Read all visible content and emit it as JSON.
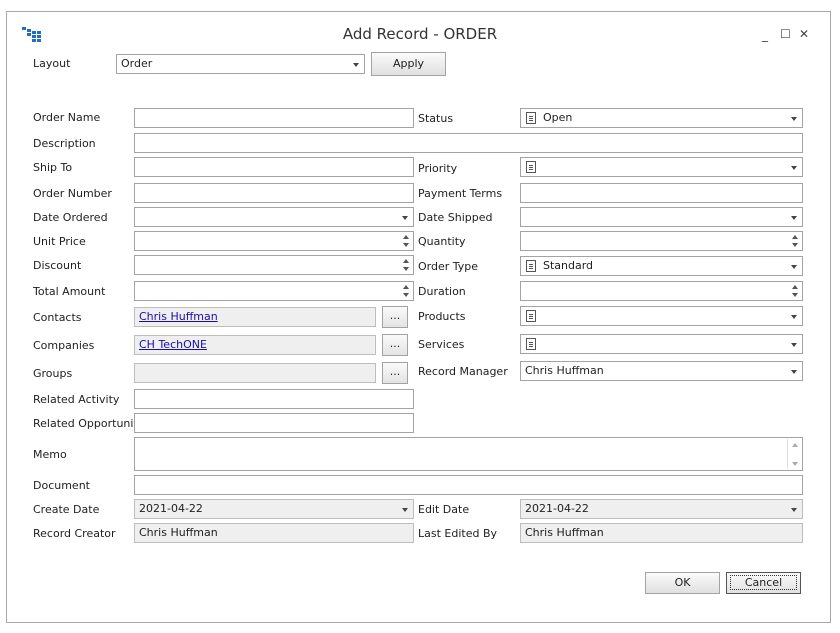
{
  "window": {
    "title": "Add Record - ORDER",
    "minimize": "_",
    "maximize": "☐",
    "close": "✕"
  },
  "layout": {
    "label": "Layout",
    "value": "Order",
    "apply_label": "Apply"
  },
  "fields": {
    "order_name": {
      "label": "Order Name",
      "value": ""
    },
    "status": {
      "label": "Status",
      "value": "Open"
    },
    "description": {
      "label": "Description",
      "value": ""
    },
    "ship_to": {
      "label": "Ship To",
      "value": ""
    },
    "priority": {
      "label": "Priority",
      "value": ""
    },
    "order_number": {
      "label": "Order Number",
      "value": ""
    },
    "payment_terms": {
      "label": "Payment Terms",
      "value": ""
    },
    "date_ordered": {
      "label": "Date Ordered",
      "value": ""
    },
    "date_shipped": {
      "label": "Date Shipped",
      "value": ""
    },
    "unit_price": {
      "label": "Unit Price",
      "value": ""
    },
    "quantity": {
      "label": "Quantity",
      "value": ""
    },
    "discount": {
      "label": "Discount",
      "value": ""
    },
    "order_type": {
      "label": "Order Type",
      "value": "Standard"
    },
    "total_amount": {
      "label": "Total Amount",
      "value": ""
    },
    "duration": {
      "label": "Duration",
      "value": ""
    },
    "contacts": {
      "label": "Contacts",
      "value": "Chris Huffman"
    },
    "products": {
      "label": "Products",
      "value": ""
    },
    "companies": {
      "label": "Companies",
      "value": "CH TechONE"
    },
    "services": {
      "label": "Services",
      "value": ""
    },
    "groups": {
      "label": "Groups",
      "value": ""
    },
    "record_manager": {
      "label": "Record Manager",
      "value": "Chris Huffman"
    },
    "related_activity": {
      "label": "Related Activity",
      "value": ""
    },
    "related_opportunity": {
      "label": "Related Opportunity",
      "value": ""
    },
    "memo": {
      "label": "Memo",
      "value": ""
    },
    "document": {
      "label": "Document",
      "value": ""
    },
    "create_date": {
      "label": "Create Date",
      "value": "2021-04-22"
    },
    "edit_date": {
      "label": "Edit Date",
      "value": "2021-04-22"
    },
    "record_creator": {
      "label": "Record Creator",
      "value": "Chris Huffman"
    },
    "last_edited_by": {
      "label": "Last Edited By",
      "value": "Chris Huffman"
    }
  },
  "ellipsis": "...",
  "buttons": {
    "ok": "OK",
    "cancel": "Cancel"
  }
}
